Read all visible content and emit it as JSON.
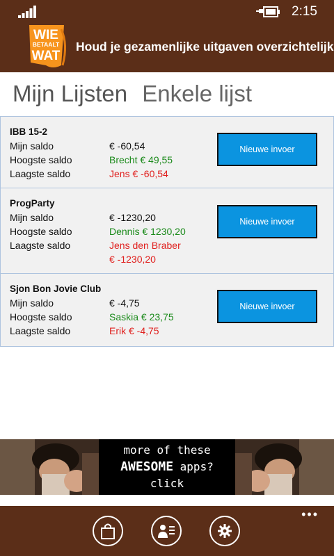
{
  "status_bar": {
    "time": "2:15"
  },
  "header": {
    "logo": {
      "line1": "WIE",
      "line2": "BETAALT",
      "line3": "WAT"
    },
    "title": "Houd je gezamenlijke uitgaven overzichtelijk"
  },
  "pivot": {
    "tabs": [
      "Mijn Lijsten",
      "Enkele lijst"
    ]
  },
  "lists": [
    {
      "name": "IBB 15-2",
      "labels": [
        "Mijn saldo",
        "Hoogste saldo",
        "Laagste saldo"
      ],
      "mijn_saldo": "€ -60,54",
      "hoogste_saldo": "Brecht € 49,55",
      "laagste_saldo": "Jens € -60,54",
      "button": "Nieuwe invoer"
    },
    {
      "name": "ProgParty",
      "labels": [
        "Mijn saldo",
        "Hoogste saldo",
        "Laagste saldo"
      ],
      "mijn_saldo": "€ -1230,20",
      "hoogste_saldo": "Dennis € 1230,20",
      "laagste_saldo_name": "Jens den Braber",
      "laagste_saldo_amount": "€ -1230,20",
      "button": "Nieuwe invoer"
    },
    {
      "name": "Sjon Bon Jovie Club",
      "labels": [
        "Mijn saldo",
        "Hoogste saldo",
        "Laagste saldo"
      ],
      "mijn_saldo": "€ -4,75",
      "hoogste_saldo": "Saskia € 23,75",
      "laagste_saldo": "Erik € -4,75",
      "button": "Nieuwe invoer"
    }
  ],
  "ad": {
    "line1": "more of these",
    "line2_bold": "AWESOME",
    "line2_rest": " apps?",
    "line3": "click"
  },
  "app_bar": {
    "buttons": [
      "shopping-bag-icon",
      "contact-list-icon",
      "settings-gear-icon"
    ],
    "more": "•••"
  },
  "colors": {
    "brand_brown": "#5b2e18",
    "logo_orange": "#f7941d",
    "button_blue": "#0b94e0",
    "positive_green": "#1b8a1b",
    "negative_red": "#e0201e"
  }
}
